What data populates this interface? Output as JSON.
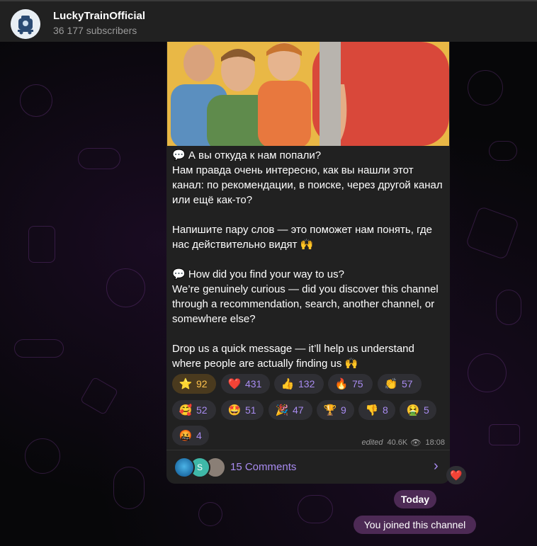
{
  "header": {
    "channel_name": "LuckyTrainOfficial",
    "subscribers": "36 177 subscribers"
  },
  "post": {
    "text": "💬 А вы откуда к нам попали?\nНам правда очень интересно, как вы нашли этот канал: по рекомендации, в поиске, через другой канал или ещё как-то?\n\nНапишите пару слов — это поможет нам понять, где нас действительно видят 🙌\n\n💬 How did you find your way to us?\nWe’re genuinely curious — did you discover this channel through a recommendation, search, another channel, or somewhere else?\n\nDrop us a quick message — it’ll help us understand where people are actually finding us 🙌",
    "reactions": [
      {
        "emoji": "⭐",
        "count": "92",
        "name": "star-reaction"
      },
      {
        "emoji": "❤️",
        "count": "431",
        "name": "heart-reaction"
      },
      {
        "emoji": "👍",
        "count": "132",
        "name": "thumbs-up-reaction"
      },
      {
        "emoji": "🔥",
        "count": "75",
        "name": "fire-reaction"
      },
      {
        "emoji": "👏",
        "count": "57",
        "name": "clap-reaction"
      },
      {
        "emoji": "🥰",
        "count": "52",
        "name": "smiling-hearts-reaction"
      },
      {
        "emoji": "🤩",
        "count": "51",
        "name": "star-struck-reaction"
      },
      {
        "emoji": "🎉",
        "count": "47",
        "name": "party-reaction"
      },
      {
        "emoji": "🏆",
        "count": "9",
        "name": "trophy-reaction"
      },
      {
        "emoji": "👎",
        "count": "8",
        "name": "thumbs-down-reaction"
      },
      {
        "emoji": "🤮",
        "count": "5",
        "name": "vomit-reaction"
      },
      {
        "emoji": "🤬",
        "count": "4",
        "name": "cursing-reaction"
      }
    ],
    "edited_label": "edited",
    "views": "40.6K",
    "time": "18:08",
    "comments_label": "15 Comments",
    "own_reaction": "❤️"
  },
  "service": {
    "date_label": "Today",
    "joined_label": "You joined this channel"
  },
  "colors": {
    "accent": "#a88bf0",
    "header_bg": "#212121",
    "bubble_bg": "#212121",
    "service_pill": "#4d2a55"
  }
}
